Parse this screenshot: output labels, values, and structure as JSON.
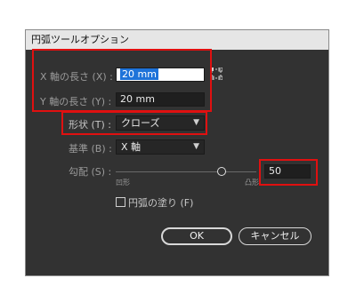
{
  "dialog": {
    "title": "円弧ツールオプション",
    "x_length_label": "X 軸の長さ (X) :",
    "x_length_value": "20 mm",
    "y_length_label": "Y 軸の長さ (Y) :",
    "y_length_value": "20 mm",
    "shape_label": "形状 (T) :",
    "shape_value": "クローズ",
    "base_label": "基準 (B) :",
    "base_value": "X 軸",
    "slope_label": "勾配 (S) :",
    "slope_value": "50",
    "slope_min_label": "凹形",
    "slope_max_label": "凸形",
    "fill_label": "円弧の塗り (F)",
    "ok_label": "OK",
    "cancel_label": "キャンセル"
  },
  "slider": {
    "min": -100,
    "max": 100,
    "value": 50
  },
  "colors": {
    "dialog_bg": "#323232",
    "highlight": "#e01010",
    "selection": "#1e73d9"
  }
}
